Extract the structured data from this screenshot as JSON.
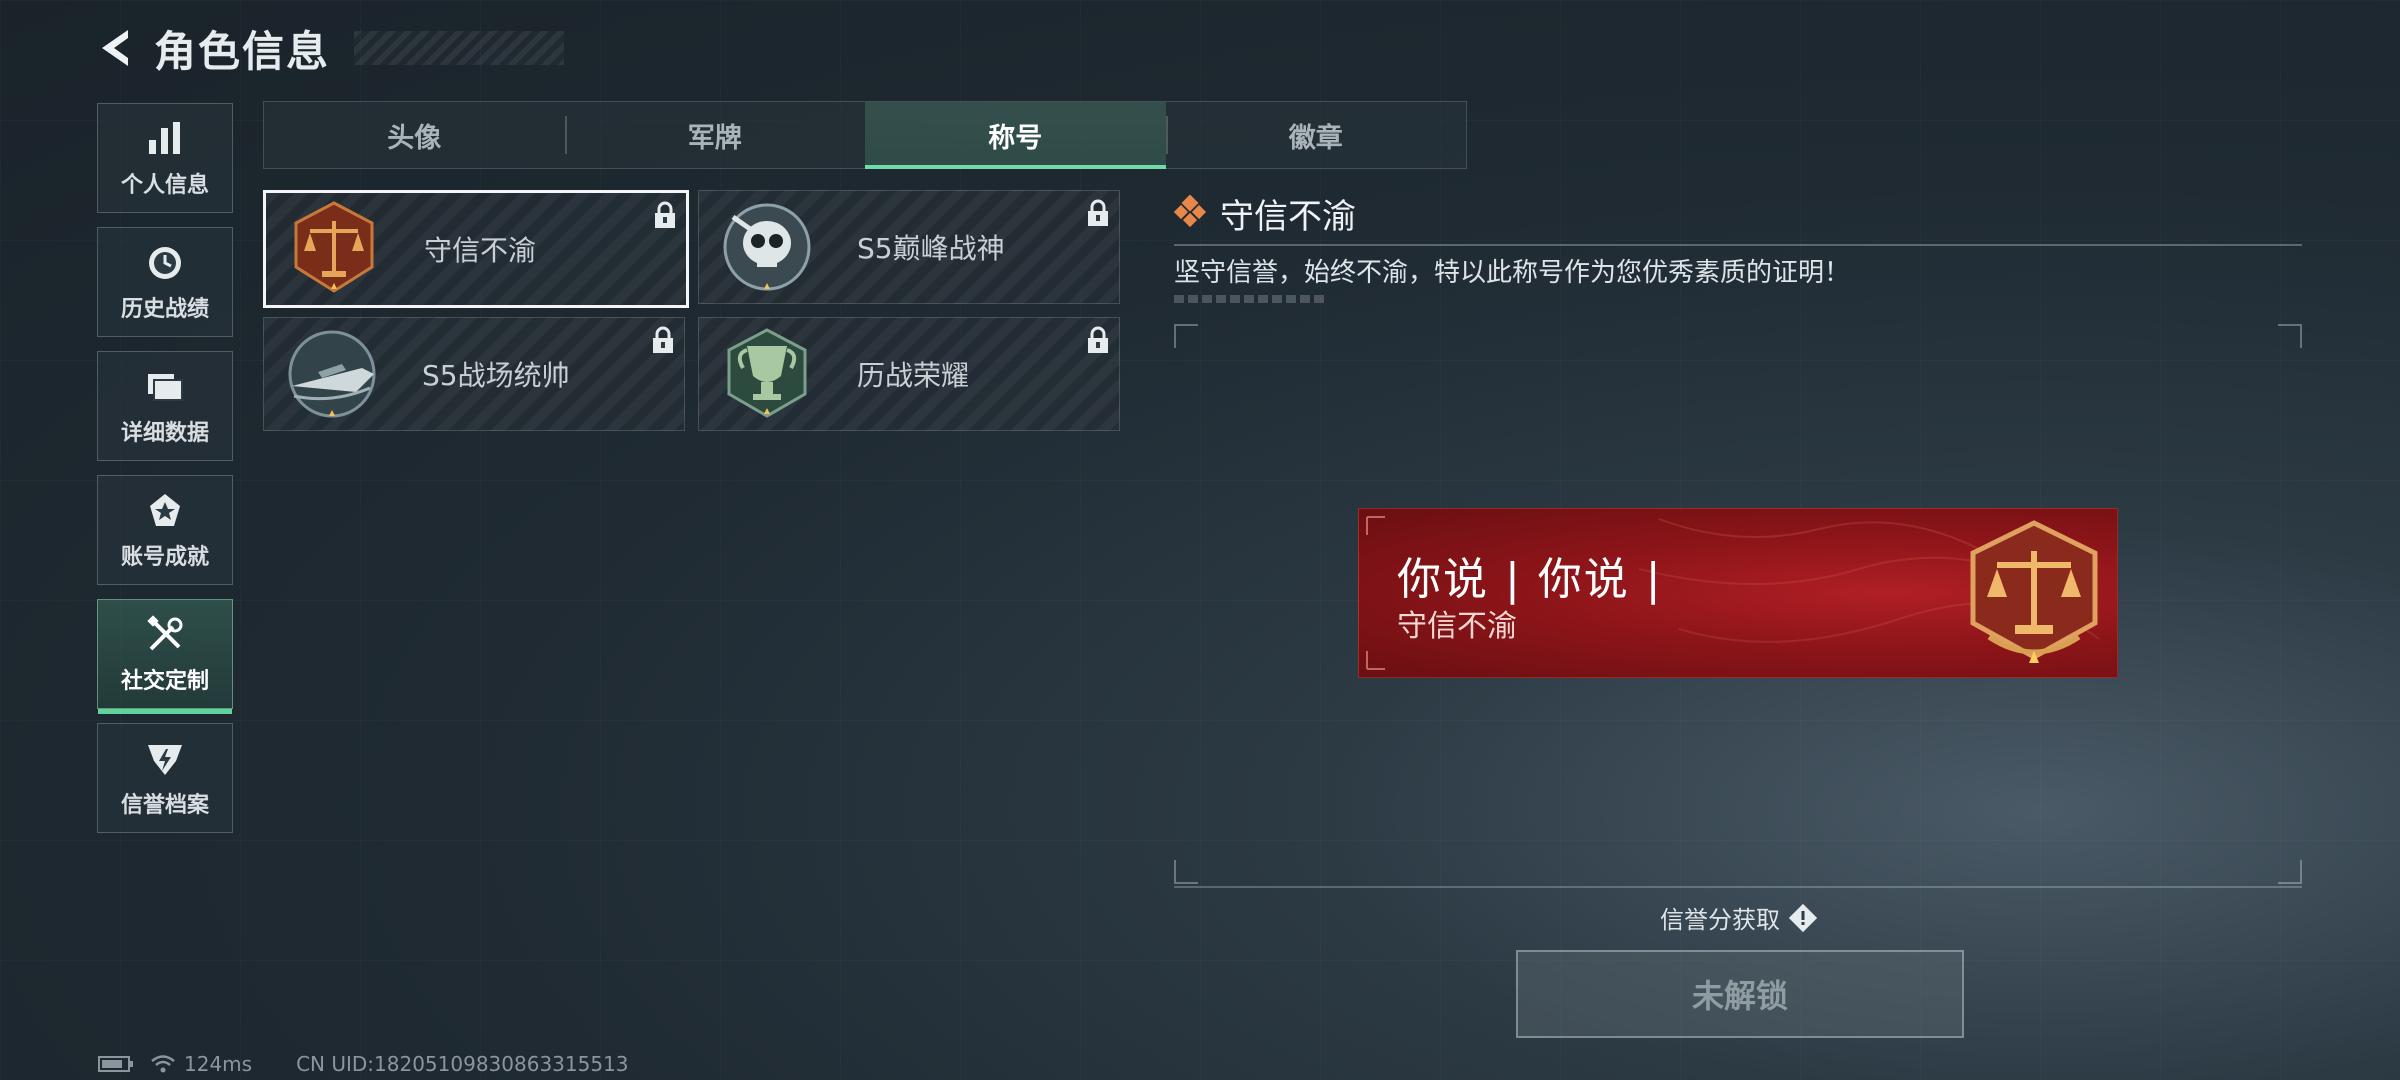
{
  "header": {
    "title": "角色信息",
    "back_icon": "back-arrow-icon"
  },
  "sidebar": {
    "items": [
      {
        "label": "个人信息",
        "icon": "bar-chart-icon",
        "active": false
      },
      {
        "label": "历史战绩",
        "icon": "clock-icon",
        "active": false
      },
      {
        "label": "详细数据",
        "icon": "folder-icon",
        "active": false
      },
      {
        "label": "账号成就",
        "icon": "medal-icon",
        "active": false
      },
      {
        "label": "社交定制",
        "icon": "tools-icon",
        "active": true
      },
      {
        "label": "信誉档案",
        "icon": "shield-icon",
        "active": false
      }
    ]
  },
  "tabs": [
    {
      "label": "头像",
      "active": false
    },
    {
      "label": "军牌",
      "active": false
    },
    {
      "label": "称号",
      "active": true
    },
    {
      "label": "徽章",
      "active": false
    }
  ],
  "titles": [
    {
      "name": "守信不渝",
      "emblem": "scales-emblem-icon",
      "locked": true,
      "selected": true
    },
    {
      "name": "S5巅峰战神",
      "emblem": "skull-emblem-icon",
      "locked": true,
      "selected": false
    },
    {
      "name": "S5战场统帅",
      "emblem": "boat-emblem-icon",
      "locked": true,
      "selected": false
    },
    {
      "name": "历战荣耀",
      "emblem": "trophy-emblem-icon",
      "locked": true,
      "selected": false
    }
  ],
  "detail": {
    "title": "守信不渝",
    "description": "坚守信誉，始终不渝，特以此称号作为您优秀素质的证明！"
  },
  "banner": {
    "player_name": "你说 | 你说 |",
    "title_text": "守信不渝"
  },
  "acquire": {
    "label": "信誉分获取"
  },
  "unlock_button": {
    "label": "未解锁"
  },
  "status": {
    "ping": "124ms",
    "uid": "CN UID:18205109830863315513"
  },
  "colors": {
    "accent": "#6fdca8",
    "banner_red": "#9e1a1f",
    "diamond_orange": "#e8874a"
  }
}
